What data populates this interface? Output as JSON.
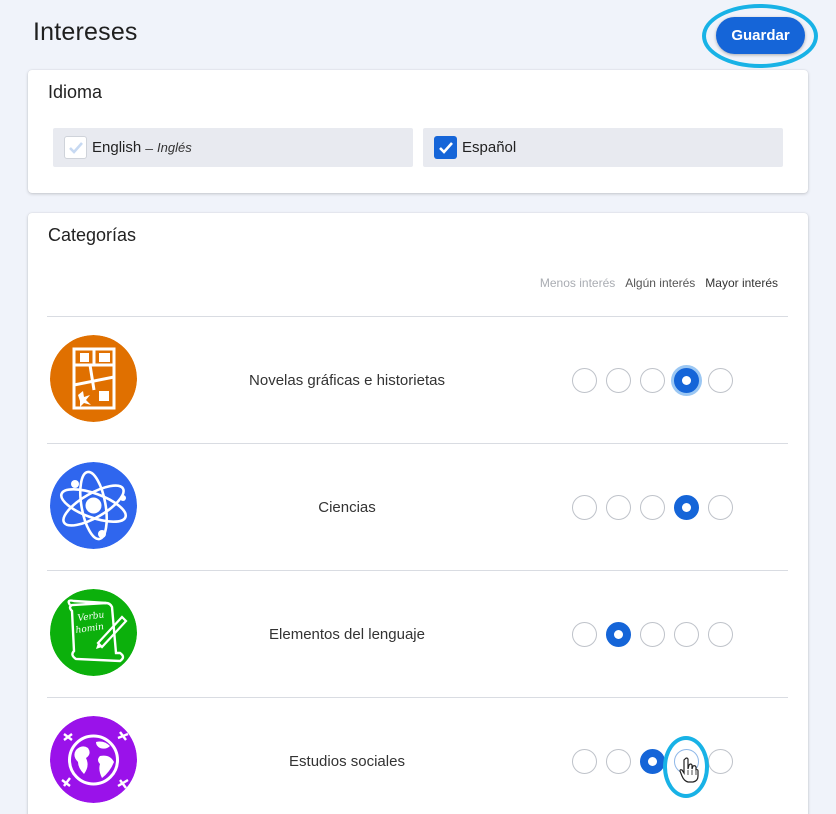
{
  "page": {
    "title": "Intereses"
  },
  "toolbar": {
    "save_label": "Guardar"
  },
  "language": {
    "title": "Idioma",
    "options": [
      {
        "label": "English",
        "separator": "–",
        "native": "Inglés",
        "checked": false
      },
      {
        "label": "Español",
        "checked": true
      }
    ]
  },
  "categories": {
    "title": "Categorías",
    "scale": [
      "Menos interés",
      "Algún interés",
      "Mayor interés"
    ],
    "items": [
      {
        "label": "Novelas gráficas e historietas",
        "icon": "comic-panels-icon",
        "color": "#e07000",
        "selected": 4
      },
      {
        "label": "Ciencias",
        "icon": "atom-icon",
        "color": "#2f66ee",
        "selected": 4
      },
      {
        "label": "Elementos del lenguaje",
        "icon": "scroll-quill-icon",
        "color": "#0cb00c",
        "selected": 2,
        "scroll_text": [
          "Verbu",
          "homin"
        ]
      },
      {
        "label": "Estudios sociales",
        "icon": "globe-icon",
        "color": "#9a12ea",
        "selected": 3
      }
    ]
  },
  "colors": {
    "accent": "#1565d8",
    "highlight": "#18b2e6",
    "background": "#f0f3fa"
  }
}
